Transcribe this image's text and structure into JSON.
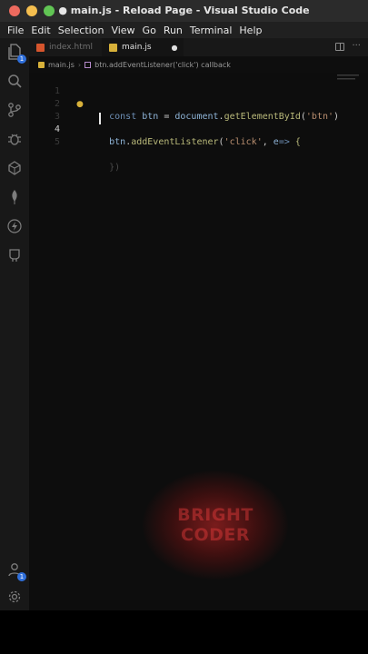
{
  "window": {
    "title": "● main.js - Reload Page - Visual Studio Code",
    "traffic_colors": [
      "#ed6a5e",
      "#f5bf4f",
      "#61c554"
    ]
  },
  "menu": [
    "File",
    "Edit",
    "Selection",
    "View",
    "Go",
    "Run",
    "Terminal",
    "Help"
  ],
  "activity_bar": {
    "top_icons": [
      "files-icon",
      "search-icon",
      "source-control-icon",
      "run-debug-icon",
      "extensions-icon",
      "mongodb-leaf-icon",
      "lightning-icon",
      "github-icon"
    ],
    "files_badge": "1",
    "account_badge": "1",
    "bottom_icons": [
      "account-icon",
      "settings-gear-icon"
    ]
  },
  "tabs": [
    {
      "label": "index.html",
      "active": false,
      "icon_color": "#d6552d"
    },
    {
      "label": "main.js",
      "active": true,
      "icon_color": "#d8b13a",
      "modified_dot": "●"
    }
  ],
  "breadcrumb": [
    "main.js",
    "btn.addEventListener('click') callback"
  ],
  "editor": {
    "lines": [
      {
        "number": "1",
        "tokens": [
          [
            "kw",
            "const "
          ],
          [
            "var",
            "btn"
          ],
          [
            "plain",
            " = "
          ],
          [
            "var",
            "document"
          ],
          [
            "plain",
            "."
          ],
          [
            "fn",
            "getElementById"
          ],
          [
            "plain",
            "("
          ],
          [
            "str",
            "'btn'"
          ],
          [
            "plain",
            ")"
          ]
        ]
      },
      {
        "number": "2",
        "tokens": []
      },
      {
        "number": "3",
        "tokens": [
          [
            "var",
            "btn"
          ],
          [
            "plain",
            "."
          ],
          [
            "fn",
            "addEventListener"
          ],
          [
            "plain",
            "("
          ],
          [
            "str",
            "'click'"
          ],
          [
            "plain",
            ", "
          ],
          [
            "var",
            "e"
          ],
          [
            "kw",
            "=> "
          ],
          [
            "plain",
            "{"
          ]
        ]
      },
      {
        "number": "4",
        "tokens": []
      },
      {
        "number": "5",
        "tokens": [
          [
            "plain",
            "})"
          ]
        ]
      }
    ],
    "current_line": "4"
  },
  "watermark": {
    "line1": "BRIGHT",
    "line2": "CODER"
  }
}
